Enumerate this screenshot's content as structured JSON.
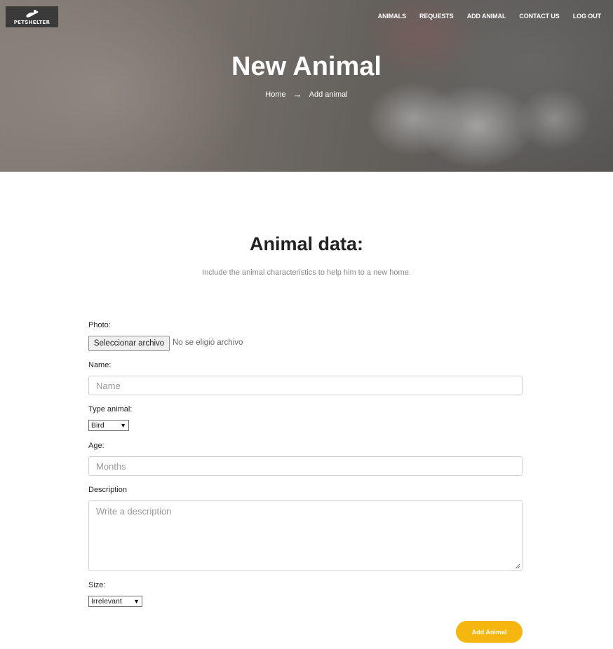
{
  "header": {
    "logo_text": "PETSHELTER",
    "nav": [
      "ANIMALS",
      "REQUESTS",
      "ADD ANIMAL",
      "CONTACT US",
      "LOG OUT"
    ]
  },
  "hero": {
    "title": "New Animal",
    "breadcrumb": {
      "home": "Home",
      "arrow": "→",
      "current": "Add animal"
    }
  },
  "form_intro": {
    "title": "Animal data:",
    "subtitle": "Include the animal characteristics to help him to a new home."
  },
  "form": {
    "photo": {
      "label": "Photo:",
      "button": "Seleccionar archivo",
      "status": "No se eligió archivo"
    },
    "name": {
      "label": "Name:",
      "placeholder": "Name"
    },
    "type": {
      "label": "Type animal:",
      "selected": "Bird"
    },
    "age": {
      "label": "Age:",
      "placeholder": "Months"
    },
    "description": {
      "label": "Description",
      "placeholder": "Write a description"
    },
    "size": {
      "label": "Size:",
      "selected": "Irrelevant"
    },
    "submit_label": "Add Animal"
  },
  "colors": {
    "accent": "#f5b70f"
  }
}
